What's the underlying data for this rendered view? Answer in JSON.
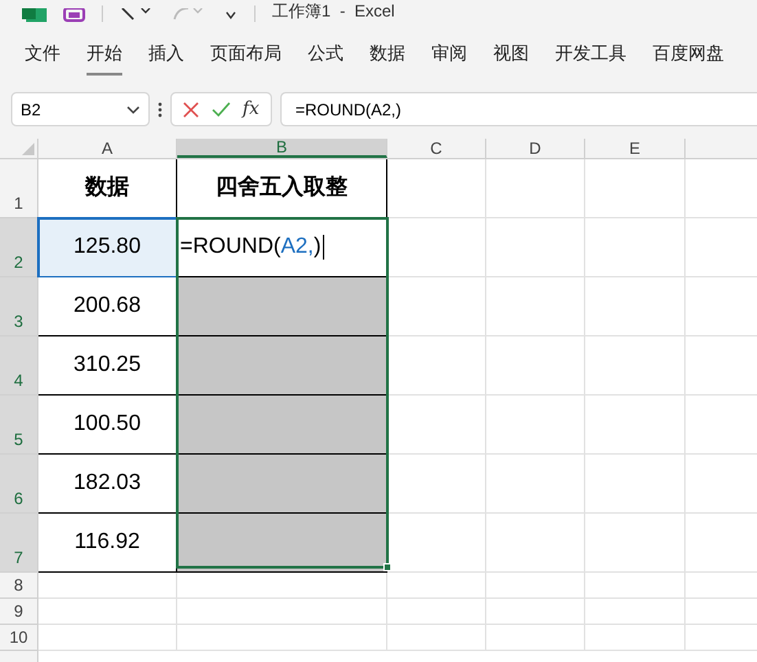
{
  "title": "工作簿1  -  Excel",
  "menu": [
    {
      "label": "文件",
      "selected": false
    },
    {
      "label": "开始",
      "selected": true
    },
    {
      "label": "插入",
      "selected": false
    },
    {
      "label": "页面布局",
      "selected": false
    },
    {
      "label": "公式",
      "selected": false
    },
    {
      "label": "数据",
      "selected": false
    },
    {
      "label": "审阅",
      "selected": false
    },
    {
      "label": "视图",
      "selected": false
    },
    {
      "label": "开发工具",
      "selected": false
    },
    {
      "label": "百度网盘",
      "selected": false
    }
  ],
  "name_box": "B2",
  "fx_label": "fx",
  "formula": "=ROUND(A2,)",
  "columns": [
    {
      "label": "A",
      "selected": false
    },
    {
      "label": "B",
      "selected": true
    },
    {
      "label": "C",
      "selected": false
    },
    {
      "label": "D",
      "selected": false
    },
    {
      "label": "E",
      "selected": false
    }
  ],
  "rows": [
    {
      "number": "1",
      "selected": false,
      "a": "数据",
      "b": "四舍五入取整",
      "header": true
    },
    {
      "number": "2",
      "selected": true,
      "a": "125.80",
      "referenced": true,
      "editing": true,
      "b_parts": [
        {
          "text": "=ROUND(",
          "kind": "plain"
        },
        {
          "text": "A2,",
          "kind": "ref"
        },
        {
          "text": ")",
          "kind": "plain"
        }
      ]
    },
    {
      "number": "3",
      "selected": true,
      "a": "200.68",
      "shaded": true
    },
    {
      "number": "4",
      "selected": true,
      "a": "310.25",
      "shaded": true
    },
    {
      "number": "5",
      "selected": true,
      "a": "100.50",
      "shaded": true
    },
    {
      "number": "6",
      "selected": true,
      "a": "182.03",
      "shaded": true
    },
    {
      "number": "7",
      "selected": true,
      "a": "116.92",
      "shaded": true
    }
  ],
  "empty_rows": [
    {
      "number": "8"
    },
    {
      "number": "9"
    },
    {
      "number": "10"
    }
  ]
}
